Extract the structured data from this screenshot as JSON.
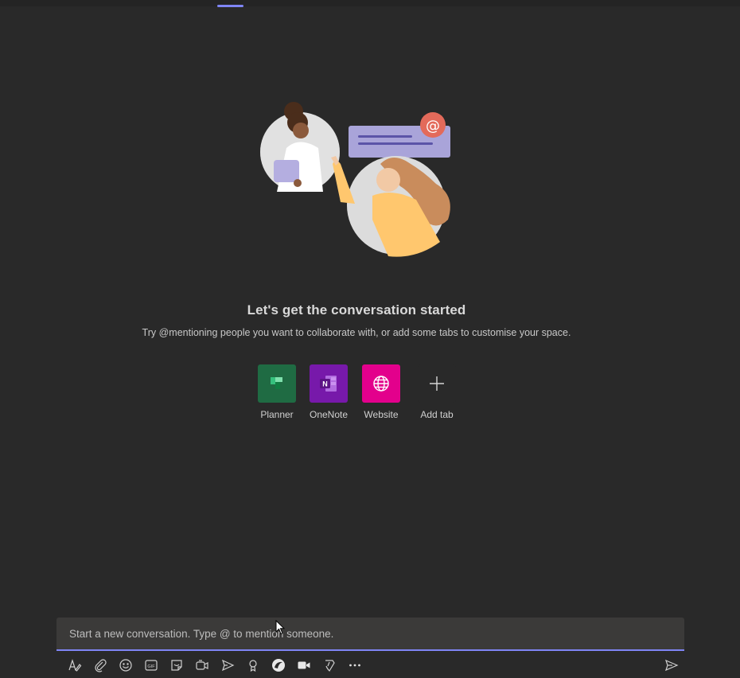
{
  "empty_state": {
    "title": "Let's get the conversation started",
    "subtitle": "Try @mentioning people you want to collaborate with, or add some tabs to customise your space."
  },
  "apps": [
    {
      "label": "Planner",
      "color": "#1f6b43",
      "icon": "planner-icon"
    },
    {
      "label": "OneNote",
      "color": "#7719aa",
      "icon": "onenote-icon"
    },
    {
      "label": "Website",
      "color": "#e3008c",
      "icon": "globe-icon"
    },
    {
      "label": "Add tab",
      "color": "#292929",
      "icon": "plus-icon"
    }
  ],
  "composer": {
    "placeholder": "Start a new conversation. Type @ to mention someone."
  },
  "toolbar": {
    "icons": [
      "format-icon",
      "attach-icon",
      "emoji-icon",
      "gif-icon",
      "sticker-icon",
      "meet-now-icon",
      "stream-icon",
      "praise-icon",
      "loop-icon",
      "video-icon",
      "approvals-icon",
      "more-options-icon"
    ],
    "send_icon": "send-icon"
  },
  "colors": {
    "background": "#292929",
    "accent": "#7f85f5"
  }
}
